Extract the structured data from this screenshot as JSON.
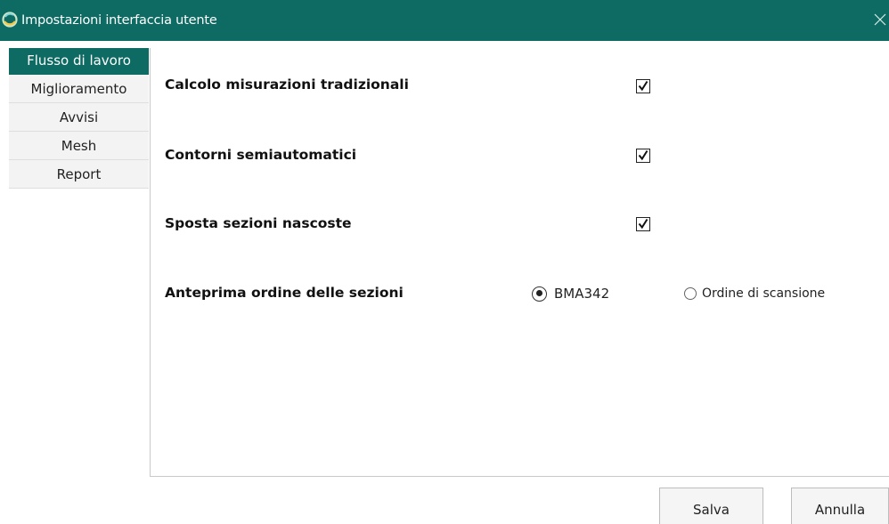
{
  "window": {
    "title": "Impostazioni interfaccia utente",
    "icon": "app-logo-icon",
    "close_icon": "close-icon",
    "accent_color": "#0e6b63"
  },
  "sidebar": {
    "items": [
      {
        "label": "Flusso di lavoro",
        "active": true
      },
      {
        "label": "Miglioramento",
        "active": false
      },
      {
        "label": "Avvisi",
        "active": false
      },
      {
        "label": "Mesh",
        "active": false
      },
      {
        "label": "Report",
        "active": false
      }
    ]
  },
  "settings": {
    "traditional_measurements": {
      "label": "Calcolo misurazioni tradizionali",
      "checked": true
    },
    "semiauto_contours": {
      "label": "Contorni semiautomatici",
      "checked": true
    },
    "move_hidden_sections": {
      "label": "Sposta sezioni nascoste",
      "checked": true
    },
    "section_order_preview": {
      "label": "Anteprima ordine delle sezioni",
      "options": [
        {
          "label": "BMA342",
          "selected": true
        },
        {
          "label": "Ordine di scansione",
          "selected": false
        }
      ]
    }
  },
  "footer": {
    "save_label": "Salva",
    "cancel_label": "Annulla"
  }
}
